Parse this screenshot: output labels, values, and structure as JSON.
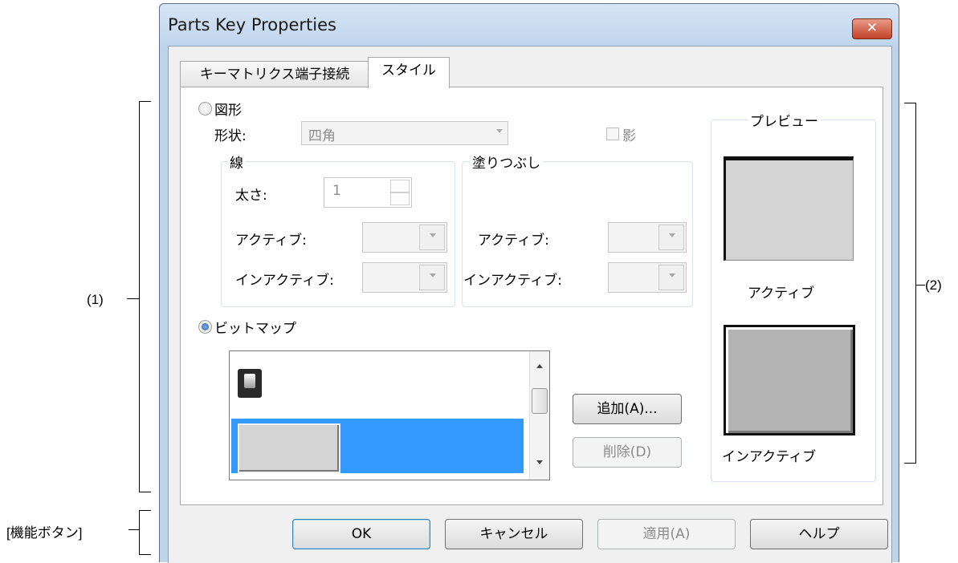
{
  "window": {
    "title": "Parts Key Properties",
    "close_glyph": "✕"
  },
  "tabs": [
    {
      "label": "キーマトリクス端子接続"
    },
    {
      "label": "スタイル"
    }
  ],
  "shape": {
    "radio_label": "図形",
    "shape_label": "形状:",
    "shape_value": "四角",
    "shadow_label": "影",
    "line_group": {
      "title": "線",
      "thickness_label": "太さ:",
      "thickness_value": "1",
      "active_label": "アクティブ:",
      "inactive_label": "インアクティブ:"
    },
    "fill_group": {
      "title": "塗りつぶし",
      "active_label": "アクティブ:",
      "inactive_label": "インアクティブ:"
    }
  },
  "bitmap": {
    "radio_label": "ビットマップ",
    "add_button": "追加(A)...",
    "delete_button": "削除(D)"
  },
  "preview": {
    "title": "プレビュー",
    "active_label": "アクティブ",
    "inactive_label": "インアクティブ"
  },
  "buttons": {
    "ok": "OK",
    "cancel": "キャンセル",
    "apply": "適用(A)",
    "help": "ヘルプ"
  },
  "annotations": {
    "area1": "(1)",
    "area2": "(2)",
    "function_buttons": "[機能ボタン]"
  },
  "colors": {
    "selection": "#3399ff",
    "title_bar": "#bfd3ea",
    "close_button": "#c3432a"
  }
}
